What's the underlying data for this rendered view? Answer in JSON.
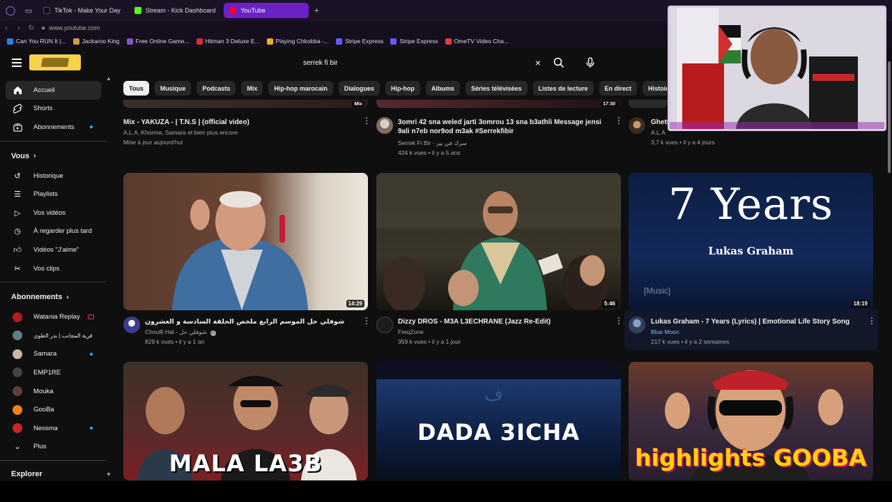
{
  "browser": {
    "tabs": [
      {
        "label": "TikTok - Make Your Day",
        "color": "#111111",
        "active": false
      },
      {
        "label": "Stream - Kick Dashboard",
        "color": "#53fc18",
        "active": false
      },
      {
        "label": "YouTube",
        "color": "#ff0033",
        "active": true
      }
    ],
    "new_tab": "+",
    "url": "www.youtube.com",
    "bookmarks": [
      {
        "label": "Can You RUN It |...",
        "color": "#1e88e5"
      },
      {
        "label": "Jackaroo King",
        "color": "#c8a24a"
      },
      {
        "label": "Free Online Game...",
        "color": "#7e57c2"
      },
      {
        "label": "Hitman 3 Deluxe E...",
        "color": "#d32f2f"
      },
      {
        "label": "Playing Chkobba -...",
        "color": "#f9a825"
      },
      {
        "label": "Stripe Express",
        "color": "#635bff"
      },
      {
        "label": "Stripe Express",
        "color": "#635bff"
      },
      {
        "label": "OmeTV Video Cha...",
        "color": "#e53935"
      }
    ]
  },
  "search": {
    "query": "serrek fi bir",
    "clear_icon": "×"
  },
  "chips": [
    "Tous",
    "Musique",
    "Podcasts",
    "Mix",
    "Hip-hop marocain",
    "Dialogues",
    "Hip-hop",
    "Albums",
    "Séries télévisées",
    "Listes de lecture",
    "En direct",
    "Histoire"
  ],
  "sidebar": {
    "main": [
      {
        "label": "Accueil",
        "icon": "home-icon",
        "active": true
      },
      {
        "label": "Shorts",
        "icon": "shorts-icon"
      },
      {
        "label": "Abonnements",
        "icon": "subscriptions-icon",
        "dot": true
      }
    ],
    "you_heading": "Vous",
    "you": [
      {
        "label": "Historique",
        "icon": "history-icon"
      },
      {
        "label": "Playlists",
        "icon": "playlists-icon"
      },
      {
        "label": "Vos vidéos",
        "icon": "your-videos-icon"
      },
      {
        "label": "À regarder plus tard",
        "icon": "watch-later-icon"
      },
      {
        "label": "Vidéos \"J'aime\"",
        "icon": "liked-icon"
      },
      {
        "label": "Vos clips",
        "icon": "clips-icon"
      }
    ],
    "subs_heading": "Abonnements",
    "subs": [
      {
        "label": "Watania Replay",
        "color": "#b71c1c",
        "badge": "live"
      },
      {
        "label": "قرية المجانب | بدر الطوي",
        "color": "#607d8b"
      },
      {
        "label": "Samara",
        "color": "#c9b79c",
        "badge": "dot"
      },
      {
        "label": "EMP1RE",
        "color": "#424242"
      },
      {
        "label": "Mouka",
        "color": "#5d4037"
      },
      {
        "label": "GooBa",
        "color": "#f57f17"
      },
      {
        "label": "Nessma",
        "color": "#c62828",
        "badge": "dot"
      },
      {
        "label": "Plus",
        "color": ""
      }
    ],
    "explorer_heading": "Explorer"
  },
  "top_row": [
    {
      "title": "Mix - YAKUZA - | T.N.S |  (official video)",
      "line1": "A.L.A, Khorma, Samara et bien plus encore",
      "line2": "Mise à jour aujourd'hui",
      "badge": "Mix"
    },
    {
      "title": "3omri 42 sna weled jarti 3omrou 13 sna b3athli Message jensi 9ali n7eb nor9od m3ak #Serrekfibir",
      "line1": "Serrek Fi Bir - سرك في بير",
      "line2": "424 k vues • il y a 5 ans",
      "duration": "17:30"
    },
    {
      "title": "Ghett",
      "line1": "A.L.A",
      "line2": "3,7 k vues • il y a 4 jours"
    }
  ],
  "videos": [
    {
      "title": "شوفلي حل الموسم الرابع ملخص الحلقة السادسة و العشرون",
      "channel": "Choufli Hal - شوفلي حل",
      "meta": "829 k vues • il y a 1 an",
      "duration": "14:29",
      "verified": true
    },
    {
      "title": "Dizzy DROS - M3A L3ECHRANE (Jazz Re-Edit)",
      "channel": "FreqZone",
      "meta": "359 k vues • il y a 1 jour",
      "duration": "5:46"
    },
    {
      "title": "Lukas Graham - 7 Years (Lyrics) | Emotional Life Story Song",
      "channel": "Blue Moon",
      "meta": "217 k vues • il y a 2 semaines",
      "duration": "18:19"
    }
  ],
  "thumb_text": {
    "years_big": "7 Years",
    "years_small": "Lukas Graham",
    "music": "[Music]",
    "mala": "MALA LA3B",
    "dada": "DADA 3ICHA",
    "gooba": "highlights GOOBA"
  }
}
